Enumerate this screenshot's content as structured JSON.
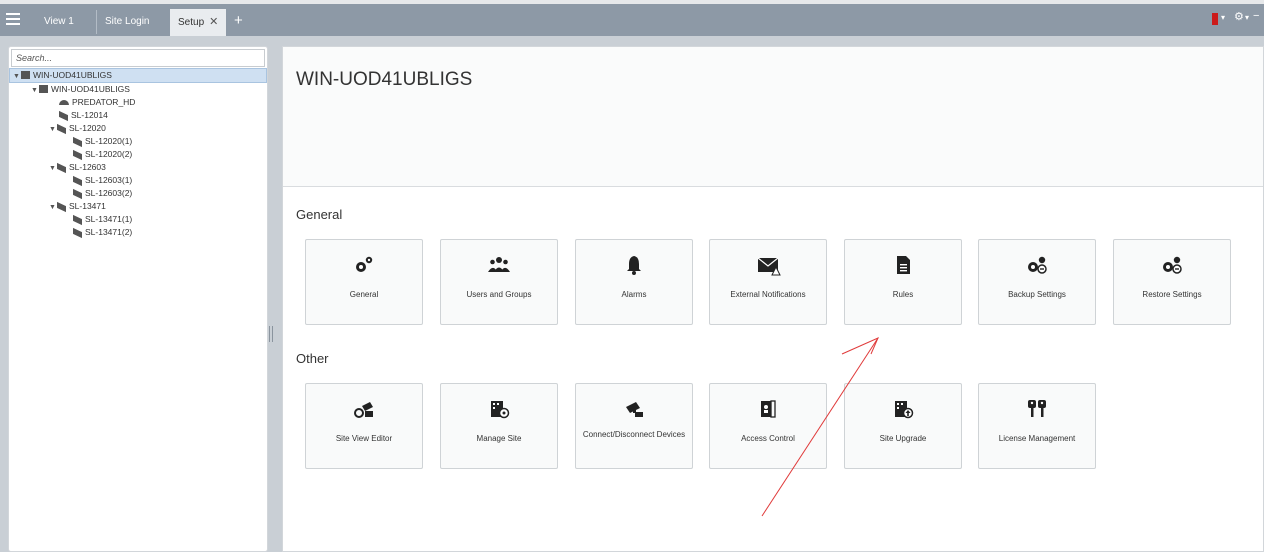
{
  "tabs": {
    "view1": "View 1",
    "sitelogin": "Site Login",
    "setup": "Setup",
    "close": "✕",
    "add": "+"
  },
  "toprightglyphs": {
    "caret1": "▾",
    "gear": "⚙",
    "caret2": "▾",
    "minimize": "−"
  },
  "sidebar": {
    "search_placeholder": "Search...",
    "tree": {
      "root": "WIN-UOD41UBLIGS",
      "server": "WIN-UOD41UBLIGS",
      "predator": "PREDATOR_HD",
      "sl12014": "SL-12014",
      "sl12020": "SL-12020",
      "sl12020_1": "SL-12020(1)",
      "sl12020_2": "SL-12020(2)",
      "sl12603": "SL-12603",
      "sl12603_1": "SL-12603(1)",
      "sl12603_2": "SL-12603(2)",
      "sl13471": "SL-13471",
      "sl13471_1": "SL-13471(1)",
      "sl13471_2": "SL-13471(2)"
    }
  },
  "main": {
    "title": "WIN-UOD41UBLIGS",
    "general": {
      "heading": "General",
      "general": "General",
      "users": "Users and Groups",
      "alarms": "Alarms",
      "notifications": "External Notifications",
      "rules": "Rules",
      "backup": "Backup Settings",
      "restore": "Restore Settings"
    },
    "other": {
      "heading": "Other",
      "siteview": "Site View Editor",
      "managesite": "Manage Site",
      "connect": "Connect/Disconnect Devices",
      "access": "Access Control",
      "upgrade": "Site Upgrade",
      "license": "License Management"
    }
  },
  "colors": {
    "accent": "#cc1a1a",
    "topbar": "#8d99a6",
    "annotation_arrow": "#e03a3a"
  }
}
